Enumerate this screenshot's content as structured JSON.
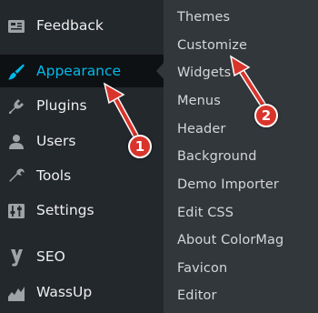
{
  "main_menu": {
    "items": [
      {
        "label": "Feedback",
        "icon": "feedback-icon"
      },
      {
        "label": "Appearance",
        "icon": "paintbrush-icon"
      },
      {
        "label": "Plugins",
        "icon": "plugin-icon"
      },
      {
        "label": "Users",
        "icon": "users-icon"
      },
      {
        "label": "Tools",
        "icon": "wrench-icon"
      },
      {
        "label": "Settings",
        "icon": "settings-sliders-icon"
      },
      {
        "label": "SEO",
        "icon": "yoast-seo-icon"
      },
      {
        "label": "WassUp",
        "icon": "stats-chart-icon"
      }
    ],
    "active_index": 1
  },
  "sub_menu": {
    "items": [
      "Themes",
      "Customize",
      "Widgets",
      "Menus",
      "Header",
      "Background",
      "Demo Importer",
      "Edit CSS",
      "About ColorMag",
      "Favicon",
      "Editor"
    ]
  },
  "annotations": {
    "badge_1": "1",
    "badge_2": "2",
    "arrow_color": "#d9342b"
  },
  "colors": {
    "sidebar_bg": "#23282d",
    "submenu_bg": "#32373c",
    "active_text": "#00b9eb"
  }
}
